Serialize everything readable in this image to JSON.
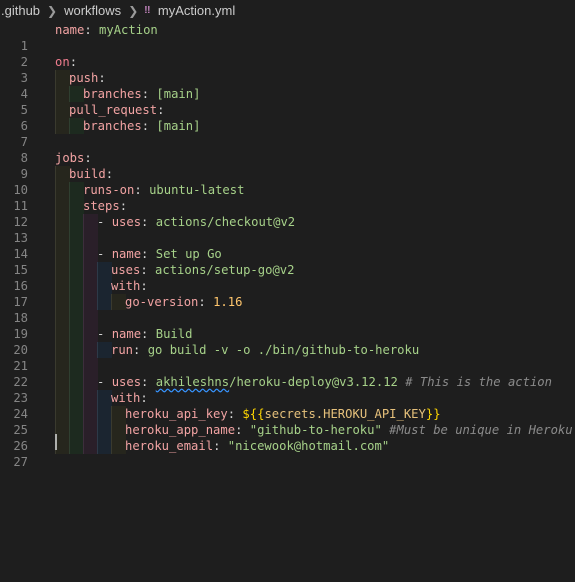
{
  "breadcrumb": {
    "folder1": ".github",
    "folder2": "workflows",
    "file_icon": "yml-icon",
    "file": "myAction.yml"
  },
  "lines": [
    {
      "n": "1",
      "k": "name",
      "v": "myAction"
    },
    {
      "n": "2"
    },
    {
      "n": "3",
      "k": "on"
    },
    {
      "n": "4",
      "k": "push"
    },
    {
      "n": "5",
      "k": "branches",
      "v": "[main]"
    },
    {
      "n": "6",
      "k": "pull_request"
    },
    {
      "n": "7",
      "k": "branches",
      "v": "[main]"
    },
    {
      "n": "8"
    },
    {
      "n": "9",
      "k": "jobs"
    },
    {
      "n": "10",
      "k": "build"
    },
    {
      "n": "11",
      "k": "runs-on",
      "v": "ubuntu-latest"
    },
    {
      "n": "12",
      "k": "steps"
    },
    {
      "n": "13",
      "k": "uses",
      "v": "actions/checkout@v2"
    },
    {
      "n": "14"
    },
    {
      "n": "15",
      "k": "name",
      "v": "Set up Go"
    },
    {
      "n": "16",
      "k": "uses",
      "v": "actions/setup-go@v2"
    },
    {
      "n": "17",
      "k": "with"
    },
    {
      "n": "18",
      "k": "go-version",
      "v": "1.16"
    },
    {
      "n": "19"
    },
    {
      "n": "20",
      "k": "name",
      "v": "Build"
    },
    {
      "n": "21",
      "k": "run",
      "v": "go build -v -o ./bin/github-to-heroku"
    },
    {
      "n": "22"
    },
    {
      "n": "23",
      "k": "uses",
      "v1": "akhileshns",
      "v2": "/heroku-deploy@v3.12.12",
      "c": "# This is the action"
    },
    {
      "n": "24",
      "k": "with"
    },
    {
      "n": "25",
      "k": "heroku_api_key",
      "e1": "${{",
      "e2": "secrets.HEROKU_API_KEY",
      "e3": "}}"
    },
    {
      "n": "26",
      "k": "heroku_app_name",
      "v": "\"github-to-heroku\"",
      "c": "#Must be unique in Heroku"
    },
    {
      "n": "27",
      "k": "heroku_email",
      "v": "\"nicewook@hotmail.com\""
    }
  ]
}
